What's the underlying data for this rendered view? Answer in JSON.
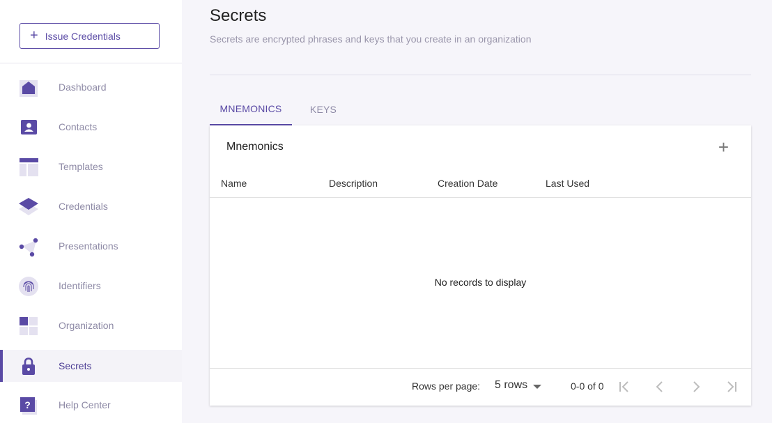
{
  "sidebar": {
    "issue_button": "Issue Credentials",
    "items": [
      {
        "label": "Dashboard",
        "icon": "dashboard-icon"
      },
      {
        "label": "Contacts",
        "icon": "contacts-icon"
      },
      {
        "label": "Templates",
        "icon": "templates-icon"
      },
      {
        "label": "Credentials",
        "icon": "credentials-icon"
      },
      {
        "label": "Presentations",
        "icon": "presentations-icon"
      },
      {
        "label": "Identifiers",
        "icon": "fingerprint-icon"
      },
      {
        "label": "Organization",
        "icon": "organization-icon"
      },
      {
        "label": "Secrets",
        "icon": "lock-icon",
        "active": true
      },
      {
        "label": "Help Center",
        "icon": "help-icon"
      }
    ]
  },
  "page": {
    "title": "Secrets",
    "subtitle": "Secrets are encrypted phrases and keys that you create in an organization"
  },
  "tabs": [
    {
      "label": "MNEMONICS",
      "active": true
    },
    {
      "label": "KEYS",
      "active": false
    }
  ],
  "table": {
    "title": "Mnemonics",
    "columns": [
      "Name",
      "Description",
      "Creation Date",
      "Last Used"
    ],
    "empty_text": "No records to display",
    "rows_per_page_label": "Rows per page:",
    "rows_per_page_value": "5 rows",
    "range_text": "0-0 of 0"
  },
  "colors": {
    "accent": "#5a4aa5",
    "icon_light": "#e4e1f0",
    "background": "#f6f5fa"
  }
}
